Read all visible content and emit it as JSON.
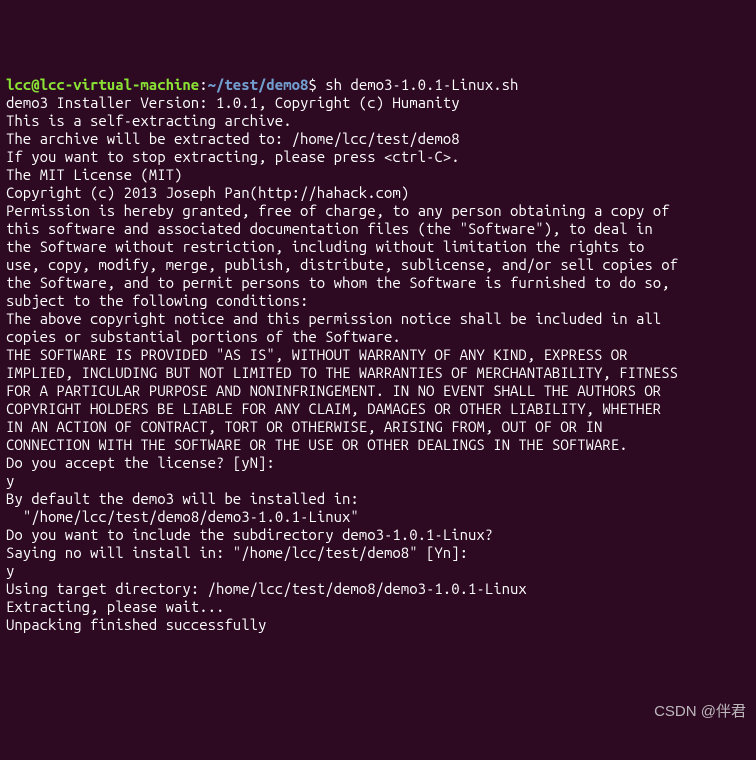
{
  "prompt": {
    "user": "lcc@lcc-virtual-machine",
    "sep": ":",
    "path": "~/test/demo8",
    "dollar": "$",
    "command": "sh demo3-1.0.1-Linux.sh"
  },
  "lines": [
    "demo3 Installer Version: 1.0.1, Copyright (c) Humanity",
    "This is a self-extracting archive.",
    "The archive will be extracted to: /home/lcc/test/demo8",
    "",
    "If you want to stop extracting, please press <ctrl-C>.",
    "The MIT License (MIT)",
    "",
    "Copyright (c) 2013 Joseph Pan(http://hahack.com)",
    "",
    "Permission is hereby granted, free of charge, to any person obtaining a copy of",
    "this software and associated documentation files (the \"Software\"), to deal in",
    "the Software without restriction, including without limitation the rights to",
    "use, copy, modify, merge, publish, distribute, sublicense, and/or sell copies of",
    "the Software, and to permit persons to whom the Software is furnished to do so,",
    "subject to the following conditions:",
    "",
    "The above copyright notice and this permission notice shall be included in all",
    "copies or substantial portions of the Software.",
    "",
    "THE SOFTWARE IS PROVIDED \"AS IS\", WITHOUT WARRANTY OF ANY KIND, EXPRESS OR",
    "IMPLIED, INCLUDING BUT NOT LIMITED TO THE WARRANTIES OF MERCHANTABILITY, FITNESS",
    "FOR A PARTICULAR PURPOSE AND NONINFRINGEMENT. IN NO EVENT SHALL THE AUTHORS OR",
    "COPYRIGHT HOLDERS BE LIABLE FOR ANY CLAIM, DAMAGES OR OTHER LIABILITY, WHETHER",
    "IN AN ACTION OF CONTRACT, TORT OR OTHERWISE, ARISING FROM, OUT OF OR IN",
    "CONNECTION WITH THE SOFTWARE OR THE USE OR OTHER DEALINGS IN THE SOFTWARE.",
    "",
    "",
    "Do you accept the license? [yN]: ",
    "y",
    "By default the demo3 will be installed in:",
    "  \"/home/lcc/test/demo8/demo3-1.0.1-Linux\"",
    "Do you want to include the subdirectory demo3-1.0.1-Linux?",
    "Saying no will install in: \"/home/lcc/test/demo8\" [Yn]: ",
    "y",
    "",
    "Using target directory: /home/lcc/test/demo8/demo3-1.0.1-Linux",
    "Extracting, please wait...",
    "",
    "Unpacking finished successfully"
  ],
  "watermark": "CSDN @伴君"
}
